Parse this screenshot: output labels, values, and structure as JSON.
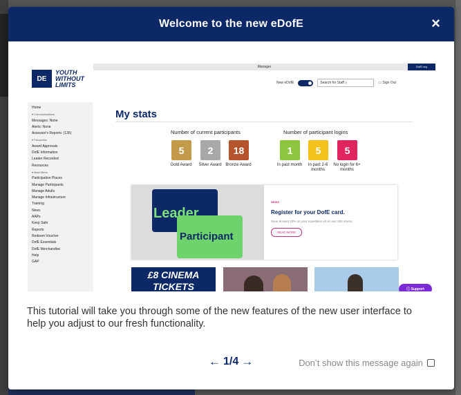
{
  "modal": {
    "title": "Welcome to the new eDofE",
    "close_glyph": "×",
    "description": "This tutorial will take you through some of the new features of the new user interface to help you adjust to our fresh functionality.",
    "pager": {
      "prev_glyph": "←",
      "page": "1/4",
      "next_glyph": "→"
    },
    "dont_show_label": "Don’t show this message again",
    "header_color": "#0c2866"
  },
  "preview": {
    "topbar_text": "Manager",
    "topbar_link": "DofE.org",
    "logo_mark": "DE",
    "logo_text": "YOUTH WITHOUT LIMITS",
    "new_edofe_label": "New eDofE",
    "search_placeholder": "Search for Staff",
    "search_icon": "search-icon",
    "sign_out": "Sign Out",
    "sidebar": [
      "Home",
      "▾ Communications",
      "Messages: None",
      "Alerts: None",
      "Assessor's Reports: (135)",
      "▾ Favourites",
      "Award Approvals",
      "DofE Information",
      "Leader Recorded",
      "Resources",
      "▾ Main Menu",
      "Participation Places",
      "Manage Participants",
      "Manage Adults",
      "Manage Infrastructure",
      "Training",
      "News",
      "AAPs",
      "Keep Safe",
      "Reports",
      "Redeem Voucher",
      "DofE Essentials",
      "DofE Merchandise",
      "Help",
      "GAP"
    ],
    "stats_title": "My stats",
    "current_participants_label": "Number of current participants",
    "logins_label": "Number of participant logins",
    "current_tiles": [
      {
        "value": "5",
        "label": "Gold Award",
        "color": "#c39a4a"
      },
      {
        "value": "2",
        "label": "Silver Award",
        "color": "#a8a8a8"
      },
      {
        "value": "18",
        "label": "Bronze Award",
        "color": "#b5532d"
      }
    ],
    "login_tiles": [
      {
        "value": "1",
        "label": "In past month",
        "color": "#8cc63f"
      },
      {
        "value": "5",
        "label": "In past 2-6 months",
        "color": "#f2c21b"
      },
      {
        "value": "5",
        "label": "No login for 6+ months",
        "color": "#e0245e"
      }
    ],
    "card_leader": "Leader",
    "card_participant": "Participant",
    "news_tag": "NEWS",
    "news_title": "Register for your DofE card.",
    "news_desc": "Save at least 10% on your expedition kit at over 200 stores.",
    "read_more": "READ MORE",
    "cinema_text": "£8 CINEMA TICKETS",
    "support_label": "Support"
  }
}
